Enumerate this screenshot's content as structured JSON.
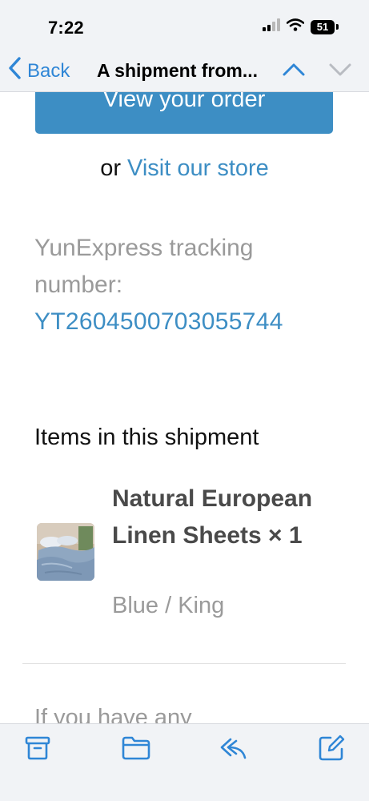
{
  "status_bar": {
    "time": "7:22",
    "battery": "51"
  },
  "nav": {
    "back_label": "Back",
    "title": "A shipment from..."
  },
  "email": {
    "view_order_button": "View your order",
    "or_text": "or ",
    "visit_store_link": "Visit our store",
    "tracking_label": "YunExpress tracking number:",
    "tracking_number": "YT2604500703055744",
    "items_heading": "Items in this shipment",
    "product": {
      "name": "Natural European Linen Sheets × 1",
      "variant": "Blue / King"
    },
    "next_paragraph_partial": "If you have any"
  },
  "colors": {
    "accent": "#3d8ec4",
    "ios_blue": "#2f86d6",
    "muted_text": "#9a9a9a",
    "bar_background": "#f1f3f6"
  },
  "icons": {
    "toolbar": [
      "archive-icon",
      "folder-icon",
      "reply-icon",
      "compose-icon"
    ]
  }
}
